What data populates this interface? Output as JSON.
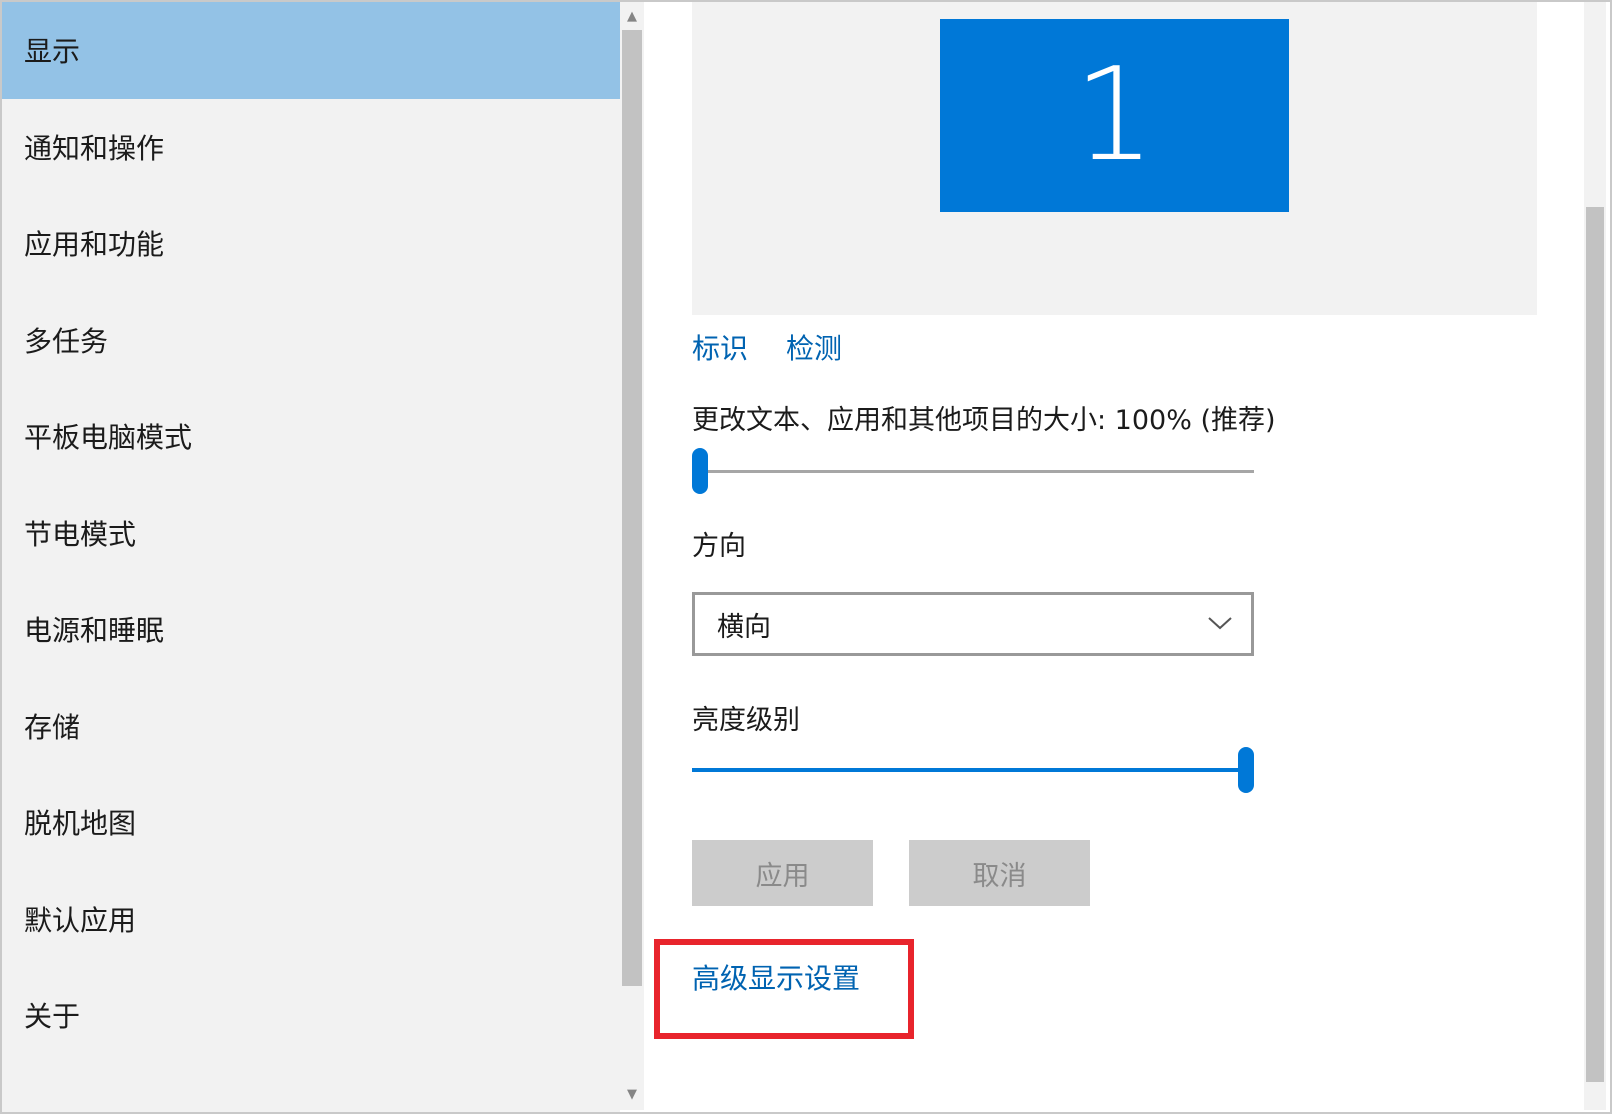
{
  "sidebar": {
    "items": [
      {
        "label": "显示",
        "selected": true
      },
      {
        "label": "通知和操作"
      },
      {
        "label": "应用和功能"
      },
      {
        "label": "多任务"
      },
      {
        "label": "平板电脑模式"
      },
      {
        "label": "节电模式"
      },
      {
        "label": "电源和睡眠"
      },
      {
        "label": "存储"
      },
      {
        "label": "脱机地图"
      },
      {
        "label": "默认应用"
      },
      {
        "label": "关于"
      }
    ]
  },
  "display": {
    "monitor_number": "1",
    "identify_link": "标识",
    "detect_link": "检测",
    "scale_label": "更改文本、应用和其他项目的大小: 100% (推荐)",
    "scale_slider_value": 0,
    "orientation_label": "方向",
    "orientation_value": "横向",
    "brightness_label": "亮度级别",
    "brightness_value": 100,
    "apply_button": "应用",
    "cancel_button": "取消",
    "advanced_link": "高级显示设置"
  },
  "colors": {
    "accent": "#0078d7",
    "selected_nav": "#93c2e6",
    "link": "#0063b1",
    "highlight_box": "#e8242c"
  }
}
